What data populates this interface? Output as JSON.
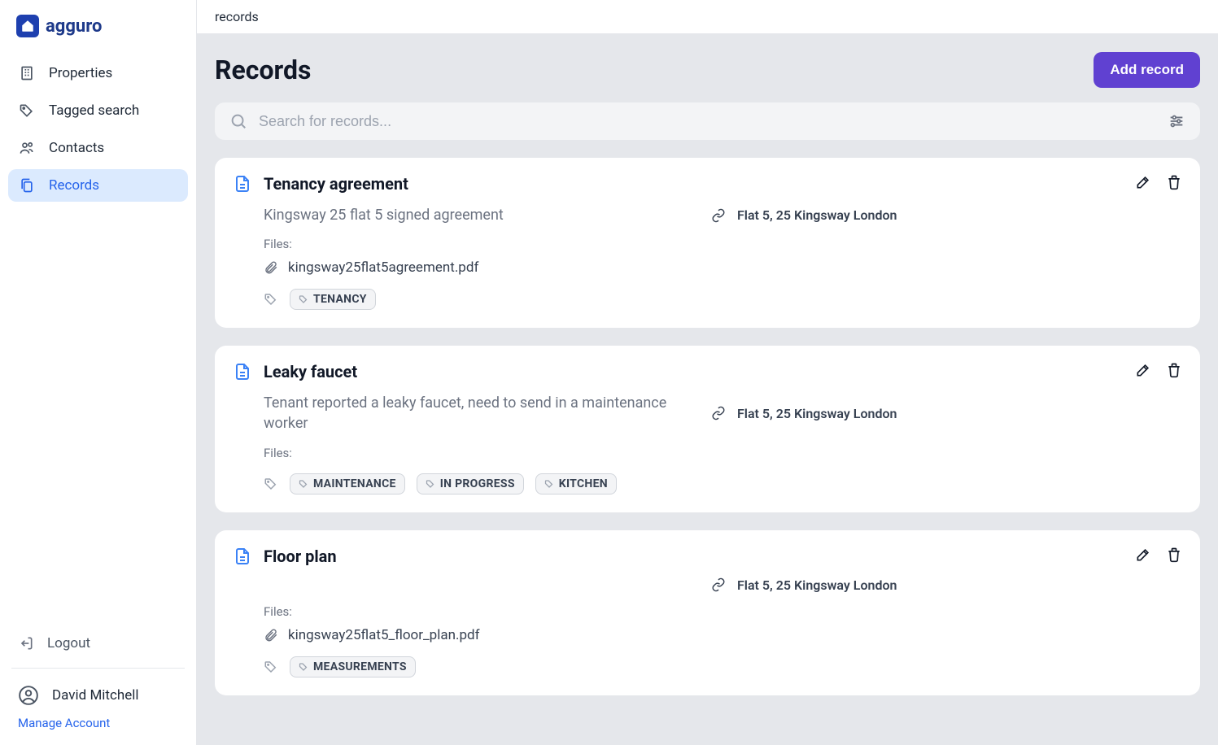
{
  "app": {
    "name": "agguro"
  },
  "sidebar": {
    "items": [
      {
        "label": "Properties",
        "icon": "building-icon",
        "active": false
      },
      {
        "label": "Tagged search",
        "icon": "tag-icon",
        "active": false
      },
      {
        "label": "Contacts",
        "icon": "people-icon",
        "active": false
      },
      {
        "label": "Records",
        "icon": "copy-icon",
        "active": true
      }
    ],
    "logout_label": "Logout",
    "user_name": "David Mitchell",
    "manage_account_label": "Manage Account"
  },
  "breadcrumb": "records",
  "page": {
    "title": "Records",
    "add_button_label": "Add record",
    "search_placeholder": "Search for records..."
  },
  "records": [
    {
      "title": "Tenancy agreement",
      "description": "Kingsway 25 flat 5 signed agreement",
      "link_label": "Flat 5, 25 Kingsway London",
      "files_label": "Files:",
      "files": [
        "kingsway25flat5agreement.pdf"
      ],
      "tags": [
        "TENANCY"
      ]
    },
    {
      "title": "Leaky faucet",
      "description": "Tenant reported a leaky faucet, need to send in a maintenance worker",
      "link_label": "Flat 5, 25 Kingsway London",
      "files_label": "Files:",
      "files": [],
      "tags": [
        "MAINTENANCE",
        "IN PROGRESS",
        "KITCHEN"
      ]
    },
    {
      "title": "Floor plan",
      "description": "",
      "link_label": "Flat 5, 25 Kingsway London",
      "files_label": "Files:",
      "files": [
        "kingsway25flat5_floor_plan.pdf"
      ],
      "tags": [
        "MEASUREMENTS"
      ]
    }
  ]
}
